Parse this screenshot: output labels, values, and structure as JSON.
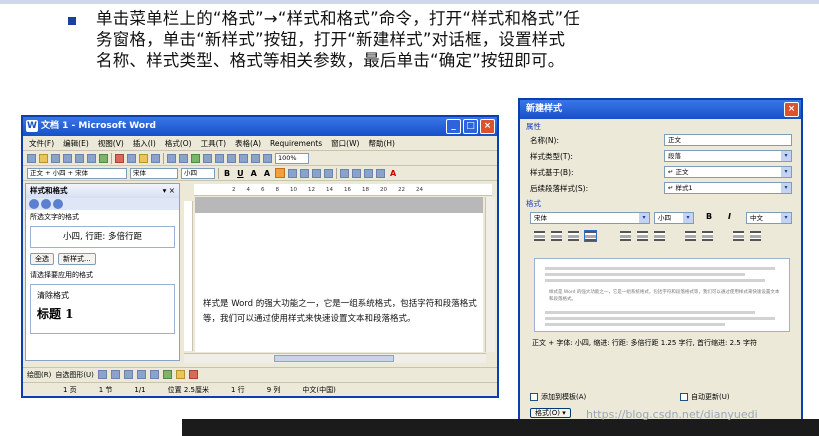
{
  "caption": {
    "lines": [
      "单击菜单栏上的“格式”→“样式和格式”命令，打开“样式和格式”任",
      "务窗格，单击“新样式”按钮，打开“新建样式”对话框，设置样式",
      "名称、样式类型、格式等相关参数，最后单击“确定”按钮即可。"
    ]
  },
  "word": {
    "title": "文档 1 - Microsoft Word",
    "menu": [
      "文件(F)",
      "编辑(E)",
      "视图(V)",
      "插入(I)",
      "格式(O)",
      "工具(T)",
      "表格(A)",
      "Requirements",
      "窗口(W)",
      "帮助(H)"
    ],
    "zoom": "100%",
    "style_select": "正文 + 小四 + 宋体",
    "font_select": "宋体",
    "size_select": "小四",
    "pane": {
      "title": "样式和格式",
      "selected_label": "所选文字的格式",
      "selected_format": "小四, 行距: 多倍行距",
      "select_all": "全选",
      "new_style": "新样式...",
      "apply_label": "请选择要应用的格式",
      "list_items": [
        "清除格式",
        "标题 1"
      ]
    },
    "doc_text": "样式是 Word 的强大功能之一，它是一组系统格式，包括字符和段落格式等，我们可以通过使用样式来快速设置文本和段落格式。",
    "drawing_label": "绘图(R)",
    "autoshape_label": "自选图形(U)",
    "status": [
      "1 页",
      "1 节",
      "1/1",
      "位置 2.5厘米",
      "1 行",
      "9 列",
      "中文(中国)"
    ]
  },
  "dialog": {
    "title": "新建样式",
    "group_props": "属性",
    "fields": [
      {
        "label": "名称(N):",
        "value": "正文"
      },
      {
        "label": "样式类型(T):",
        "value": "段落"
      },
      {
        "label": "样式基于(B):",
        "value": "↵ 正文"
      },
      {
        "label": "后续段落样式(S):",
        "value": "↵ 样式1"
      }
    ],
    "group_format": "格式",
    "font": "宋体",
    "size": "小四",
    "bold": "B",
    "italic": "I",
    "lang": "中文",
    "preview_text": "样式是 Word 的强大功能之一，它是一组系统格式，包括字符和段落格式等，我们可以通过使用样式来快速设置文本和段落格式。",
    "description": "正文 + 字体: 小四, 缩进: 行距: 多倍行距 1.25 字行, 首行缩进: 2.5 字符",
    "add_template": "添加到模板(A)",
    "auto_update": "自动更新(U)",
    "format_btn": "格式(O) ▾"
  },
  "watermark": "https://blog.csdn.net/dianyuedi"
}
